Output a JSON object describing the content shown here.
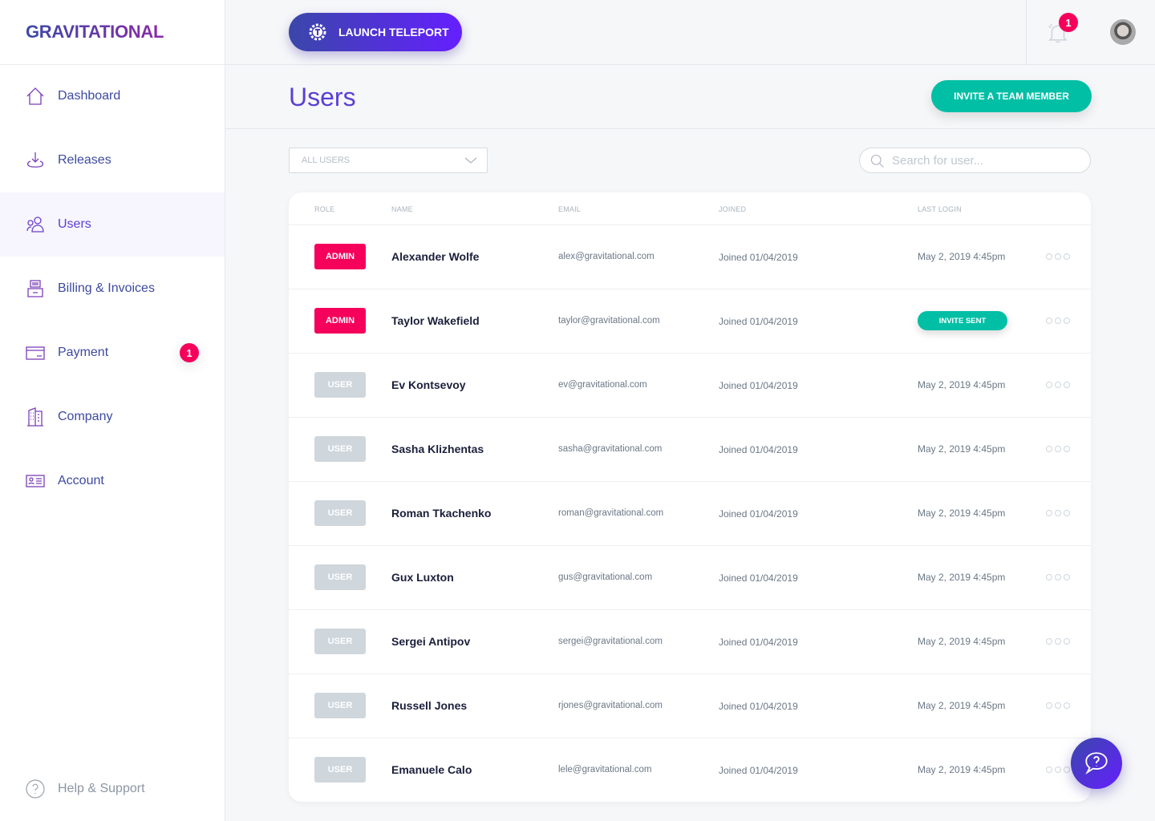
{
  "brand": "GRAVITATIONAL",
  "sidebar": {
    "items": [
      {
        "label": "Dashboard",
        "icon": "home-icon"
      },
      {
        "label": "Releases",
        "icon": "download-icon"
      },
      {
        "label": "Users",
        "icon": "users-icon",
        "active": true
      },
      {
        "label": "Billing & Invoices",
        "icon": "printer-icon"
      },
      {
        "label": "Payment",
        "icon": "credit-card-icon",
        "badge": "1"
      },
      {
        "label": "Company",
        "icon": "building-icon"
      },
      {
        "label": "Account",
        "icon": "id-card-icon"
      }
    ],
    "help": "Help & Support"
  },
  "topbar": {
    "launch": "LAUNCH TELEPORT",
    "notifications": "1"
  },
  "page": {
    "title": "Users",
    "invite": "INVITE A TEAM MEMBER",
    "filter": "ALL USERS",
    "search_placeholder": "Search for user..."
  },
  "table": {
    "headers": [
      "ROLE",
      "NAME",
      "EMAIL",
      "JOINED",
      "LAST LOGIN"
    ],
    "rows": [
      {
        "role": "ADMIN",
        "name": "Alexander Wolfe",
        "email": "alex@gravitational.com",
        "joined": "Joined  01/04/2019",
        "last_login": "May 2, 2019 4:45pm"
      },
      {
        "role": "ADMIN",
        "name": "Taylor Wakefield",
        "email": "taylor@gravitational.com",
        "joined": "Joined  01/04/2019",
        "last_login": "INVITE SENT",
        "invite": true
      },
      {
        "role": "USER",
        "name": "Ev Kontsevoy",
        "email": "ev@gravitational.com",
        "joined": "Joined  01/04/2019",
        "last_login": "May 2, 2019 4:45pm"
      },
      {
        "role": "USER",
        "name": "Sasha Klizhentas",
        "email": "sasha@gravitational.com",
        "joined": "Joined  01/04/2019",
        "last_login": "May 2, 2019 4:45pm"
      },
      {
        "role": "USER",
        "name": "Roman Tkachenko",
        "email": "roman@gravitational.com",
        "joined": "Joined  01/04/2019",
        "last_login": "May 2, 2019 4:45pm"
      },
      {
        "role": "USER",
        "name": "Gux Luxton",
        "email": "gus@gravitational.com",
        "joined": "Joined  01/04/2019",
        "last_login": "May 2, 2019 4:45pm"
      },
      {
        "role": "USER",
        "name": "Sergei Antipov",
        "email": "sergei@gravitational.com",
        "joined": "Joined  01/04/2019",
        "last_login": "May 2, 2019 4:45pm"
      },
      {
        "role": "USER",
        "name": "Russell Jones",
        "email": "rjones@gravitational.com",
        "joined": "Joined  01/04/2019",
        "last_login": "May 2, 2019 4:45pm"
      },
      {
        "role": "USER",
        "name": "Emanuele Calo",
        "email": "lele@gravitational.com",
        "joined": "Joined  01/04/2019",
        "last_login": "May 2, 2019 4:45pm"
      }
    ]
  },
  "colors": {
    "accent": "#651fff",
    "admin": "#f5005a",
    "teal": "#00bfa5",
    "nav": "#3d4a9f"
  }
}
